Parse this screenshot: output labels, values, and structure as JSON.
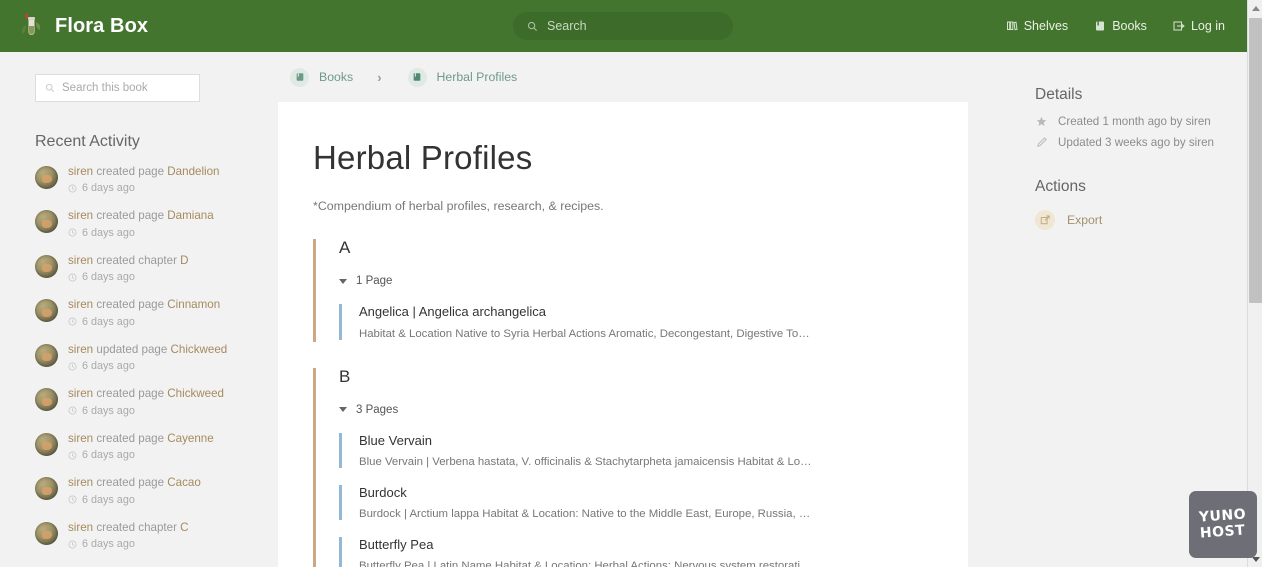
{
  "header": {
    "brand_title": "Flora Box",
    "logo_icon": "herb-jar-logo-icon",
    "search": {
      "placeholder": "Search",
      "icon": "search-icon"
    },
    "nav": [
      {
        "label": "Shelves",
        "icon": "shelves-icon"
      },
      {
        "label": "Books",
        "icon": "book-icon"
      },
      {
        "label": "Log in",
        "icon": "login-icon"
      }
    ]
  },
  "sidebar_left": {
    "book_search": {
      "placeholder": "Search this book",
      "icon": "search-icon"
    },
    "recent_activity_heading": "Recent Activity",
    "activities": [
      {
        "user": "siren",
        "action": "created page",
        "target": "Dandelion",
        "time": "6 days ago"
      },
      {
        "user": "siren",
        "action": "created page",
        "target": "Damiana",
        "time": "6 days ago"
      },
      {
        "user": "siren",
        "action": "created chapter",
        "target": "D",
        "time": "6 days ago"
      },
      {
        "user": "siren",
        "action": "created page",
        "target": "Cinnamon",
        "time": "6 days ago"
      },
      {
        "user": "siren",
        "action": "updated page",
        "target": "Chickweed",
        "time": "6 days ago"
      },
      {
        "user": "siren",
        "action": "created page",
        "target": "Chickweed",
        "time": "6 days ago"
      },
      {
        "user": "siren",
        "action": "created page",
        "target": "Cayenne",
        "time": "6 days ago"
      },
      {
        "user": "siren",
        "action": "created page",
        "target": "Cacao",
        "time": "6 days ago"
      },
      {
        "user": "siren",
        "action": "created chapter",
        "target": "C",
        "time": "6 days ago"
      }
    ]
  },
  "breadcrumb": [
    {
      "label": "Books",
      "icon": "books-icon"
    },
    {
      "label": "Herbal Profiles",
      "icon": "book-icon"
    }
  ],
  "breadcrumb_separator": "›",
  "main": {
    "title": "Herbal Profiles",
    "subtitle": "*Compendium of herbal profiles, research, & recipes.",
    "chapters": [
      {
        "title": "A",
        "count_label": "1 Page",
        "pages": [
          {
            "title": "Angelica | Angelica archangelica",
            "desc": "Habitat & Location Native to Syria Herbal Actions Aromatic, Decongestant, Digestive Tonic, C..."
          }
        ]
      },
      {
        "title": "B",
        "count_label": "3 Pages",
        "pages": [
          {
            "title": "Blue Vervain",
            "desc": "Blue Vervain | Verbena hastata, V. officinalis & Stachytarpheta jamaicensis Habitat & Location E..."
          },
          {
            "title": "Burdock",
            "desc": "Burdock | Arctium lappa Habitat & Location: Native to the Middle East, Europe, Russia, & Asia. N..."
          },
          {
            "title": "Butterfly Pea",
            "desc": "Butterfly Pea | Latin Name Habitat & Location: Herbal Actions: Nervous system restorative, Impr..."
          }
        ]
      }
    ]
  },
  "sidebar_right": {
    "details_heading": "Details",
    "details": [
      {
        "icon": "star-icon",
        "text": "Created 1 month ago by siren"
      },
      {
        "icon": "pencil-icon",
        "text": "Updated 3 weeks ago by siren"
      }
    ],
    "actions_heading": "Actions",
    "actions": [
      {
        "icon": "export-icon",
        "label": "Export"
      }
    ]
  },
  "watermark": {
    "line1": "YUNO",
    "line2": "HOST"
  },
  "colors": {
    "header_green": "#44752f",
    "search_pill": "#3c6b2a",
    "chapter_border": "#cda882",
    "page_border": "#93b9d6",
    "breadcrumb_text": "#6e9a88",
    "accent_tan": "#a58b5e",
    "page_bg": "#f2f2f2"
  }
}
